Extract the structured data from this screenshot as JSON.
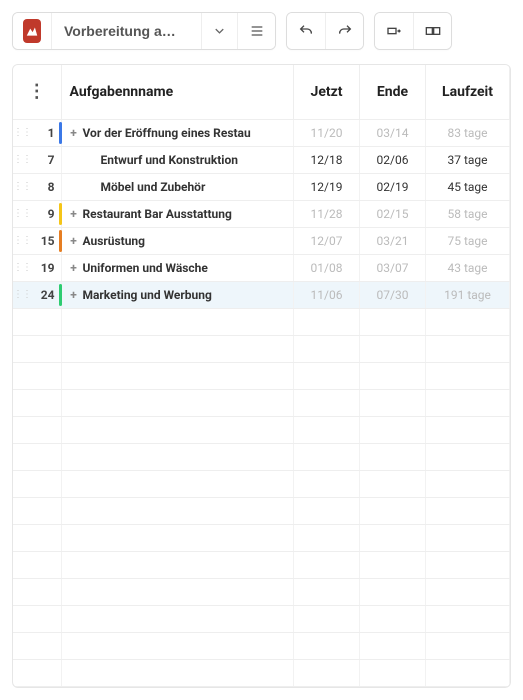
{
  "header": {
    "title": "Vorbereitung a…"
  },
  "columns": {
    "name": "Aufgabennname",
    "jetzt": "Jetzt",
    "ende": "Ende",
    "laufzeit": "Laufzeit"
  },
  "rows": [
    {
      "num": "1",
      "color": "#3b78e7",
      "indent": 0,
      "expandable": true,
      "name": "Vor der Eröffnung eines Restau",
      "jetzt": "11/20",
      "ende": "03/14",
      "laufzeit": "83 tage",
      "muted": true,
      "selected": false
    },
    {
      "num": "7",
      "color": "",
      "indent": 1,
      "expandable": false,
      "name": "Entwurf und Konstruktion",
      "jetzt": "12/18",
      "ende": "02/06",
      "laufzeit": "37 tage",
      "muted": false,
      "selected": false
    },
    {
      "num": "8",
      "color": "",
      "indent": 1,
      "expandable": false,
      "name": "Möbel und Zubehör",
      "jetzt": "12/19",
      "ende": "02/19",
      "laufzeit": "45 tage",
      "muted": false,
      "selected": false
    },
    {
      "num": "9",
      "color": "#f5c518",
      "indent": 0,
      "expandable": true,
      "name": "Restaurant Bar Ausstattung",
      "jetzt": "11/28",
      "ende": "02/15",
      "laufzeit": "58 tage",
      "muted": true,
      "selected": false
    },
    {
      "num": "15",
      "color": "#e67e22",
      "indent": 0,
      "expandable": true,
      "name": "Ausrüstung",
      "jetzt": "12/07",
      "ende": "03/21",
      "laufzeit": "75 tage",
      "muted": true,
      "selected": false
    },
    {
      "num": "19",
      "color": "",
      "indent": 0,
      "expandable": true,
      "name": "Uniformen und Wäsche",
      "jetzt": "01/08",
      "ende": "03/07",
      "laufzeit": "43 tage",
      "muted": true,
      "selected": false
    },
    {
      "num": "24",
      "color": "#2ecc71",
      "indent": 0,
      "expandable": true,
      "name": "Marketing und Werbung",
      "jetzt": "11/06",
      "ende": "07/30",
      "laufzeit": "191 tage",
      "muted": true,
      "selected": true
    }
  ],
  "emptyRows": 14
}
